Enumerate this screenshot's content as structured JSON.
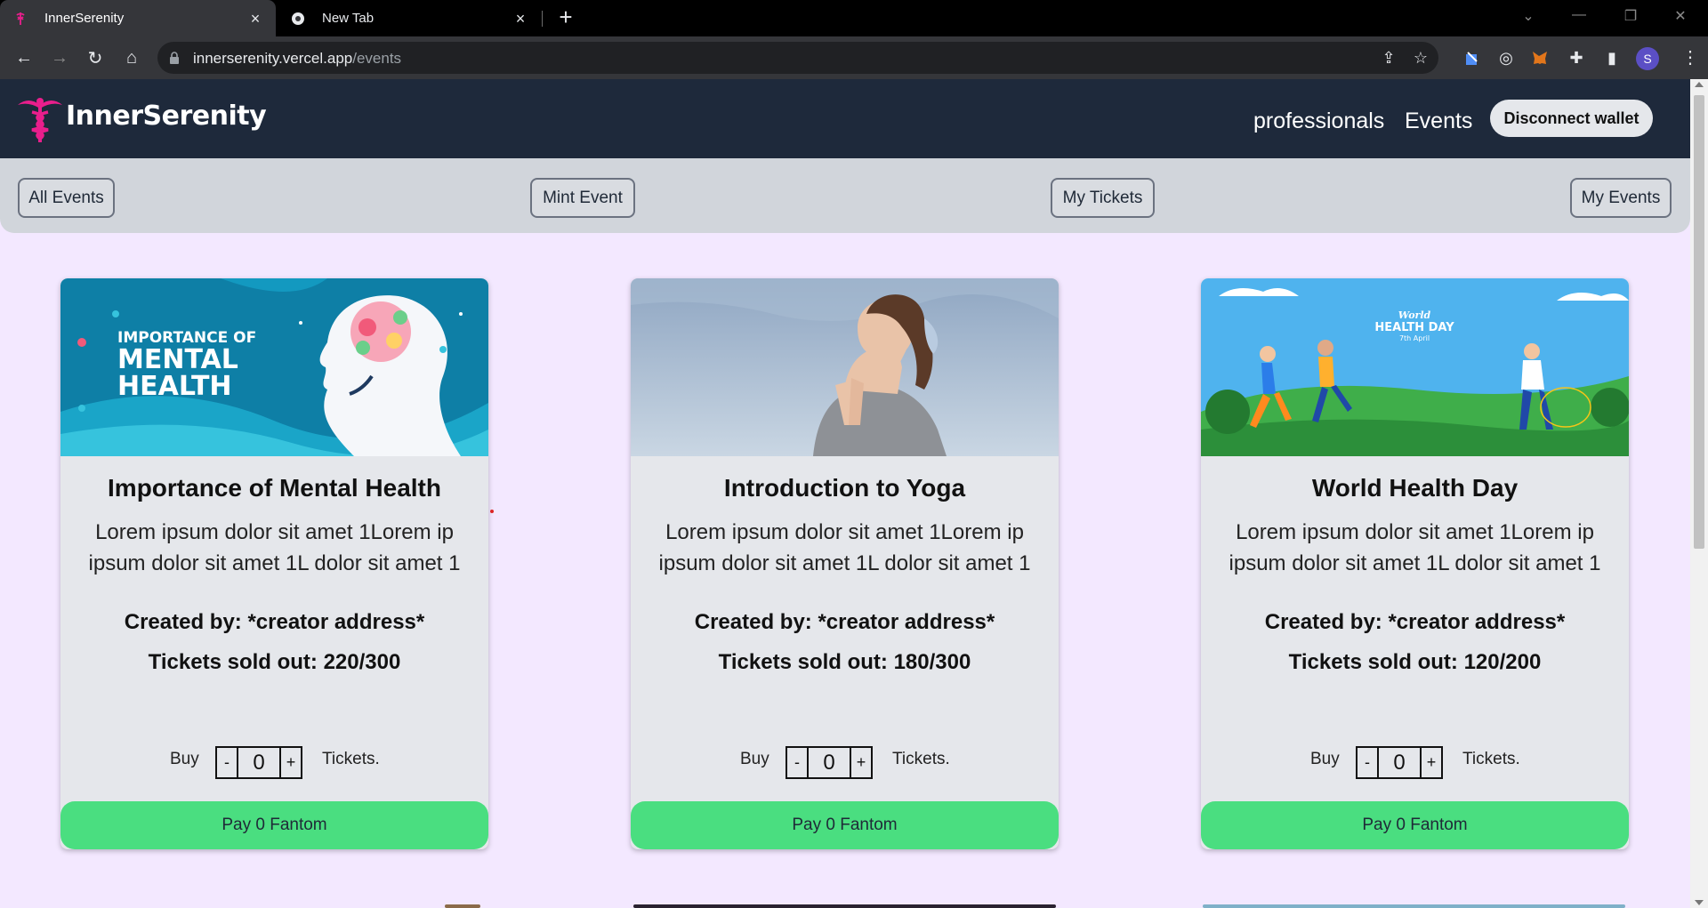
{
  "browser": {
    "tabs": [
      {
        "title": "InnerSerenity",
        "active": true,
        "icon": "caduceus-favicon"
      },
      {
        "title": "New Tab",
        "active": false,
        "icon": "chrome-favicon"
      }
    ],
    "url_host": "innerserenity.vercel.app",
    "url_path": "/events",
    "profile_initial": "S"
  },
  "navbar": {
    "brand": "InnerSerenity",
    "links": [
      "professionals",
      "Events"
    ],
    "wallet_button": "Disconnect wallet"
  },
  "subnav": {
    "buttons": [
      "All Events",
      "Mint Event",
      "My Tickets",
      "My Events"
    ]
  },
  "events": [
    {
      "title": "Importance of Mental Health",
      "desc_line1": "Lorem ipsum dolor sit amet 1Lorem ip",
      "desc_line2": "ipsum dolor sit amet 1L dolor sit amet 1",
      "creator": "Created by: *creator address*",
      "sold": "Tickets sold out: 220/300",
      "buy_label": "Buy",
      "minus": "-",
      "qty": "0",
      "plus": "+",
      "tickets_label": "Tickets.",
      "pay_label": "Pay 0 Fantom",
      "image_text": [
        "IMPORTANCE OF",
        "MENTAL",
        "HEALTH"
      ]
    },
    {
      "title": "Introduction to Yoga",
      "desc_line1": "Lorem ipsum dolor sit amet 1Lorem ip",
      "desc_line2": "ipsum dolor sit amet 1L dolor sit amet 1",
      "creator": "Created by: *creator address*",
      "sold": "Tickets sold out: 180/300",
      "buy_label": "Buy",
      "minus": "-",
      "qty": "0",
      "plus": "+",
      "tickets_label": "Tickets.",
      "pay_label": "Pay 0 Fantom"
    },
    {
      "title": "World Health Day",
      "desc_line1": "Lorem ipsum dolor sit amet 1Lorem ip",
      "desc_line2": "ipsum dolor sit amet 1L dolor sit amet 1",
      "creator": "Created by: *creator address*",
      "sold": "Tickets sold out: 120/200",
      "buy_label": "Buy",
      "minus": "-",
      "qty": "0",
      "plus": "+",
      "tickets_label": "Tickets.",
      "pay_label": "Pay 0 Fantom",
      "image_text": [
        "World",
        "HEALTH DAY",
        "7th April"
      ]
    }
  ],
  "colors": {
    "navbar_bg": "#1e293b",
    "page_bg": "#f3e8ff",
    "subnav_bg": "#d1d5db",
    "card_bg": "#e5e7eb",
    "pay_button": "#4ade80",
    "brand_accent": "#e91e8c"
  }
}
